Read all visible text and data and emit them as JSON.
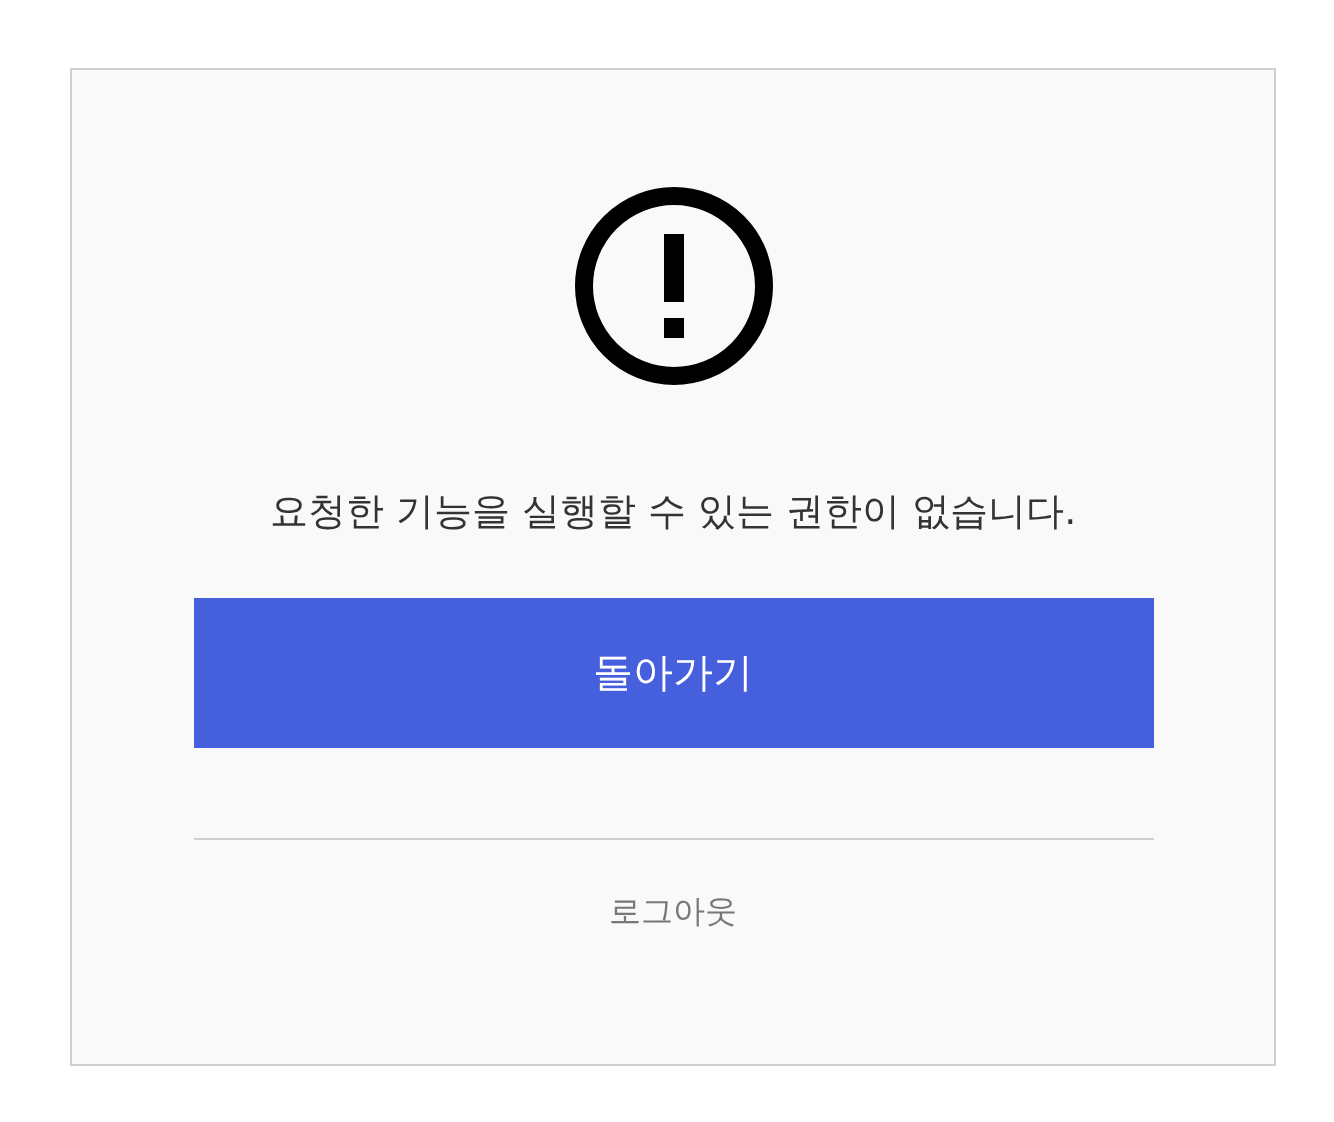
{
  "message": "요청한 기능을 실행할 수 있는 권한이 없습니다.",
  "primary_button": {
    "label": "돌아가기"
  },
  "logout_link": {
    "label": "로그아웃"
  }
}
